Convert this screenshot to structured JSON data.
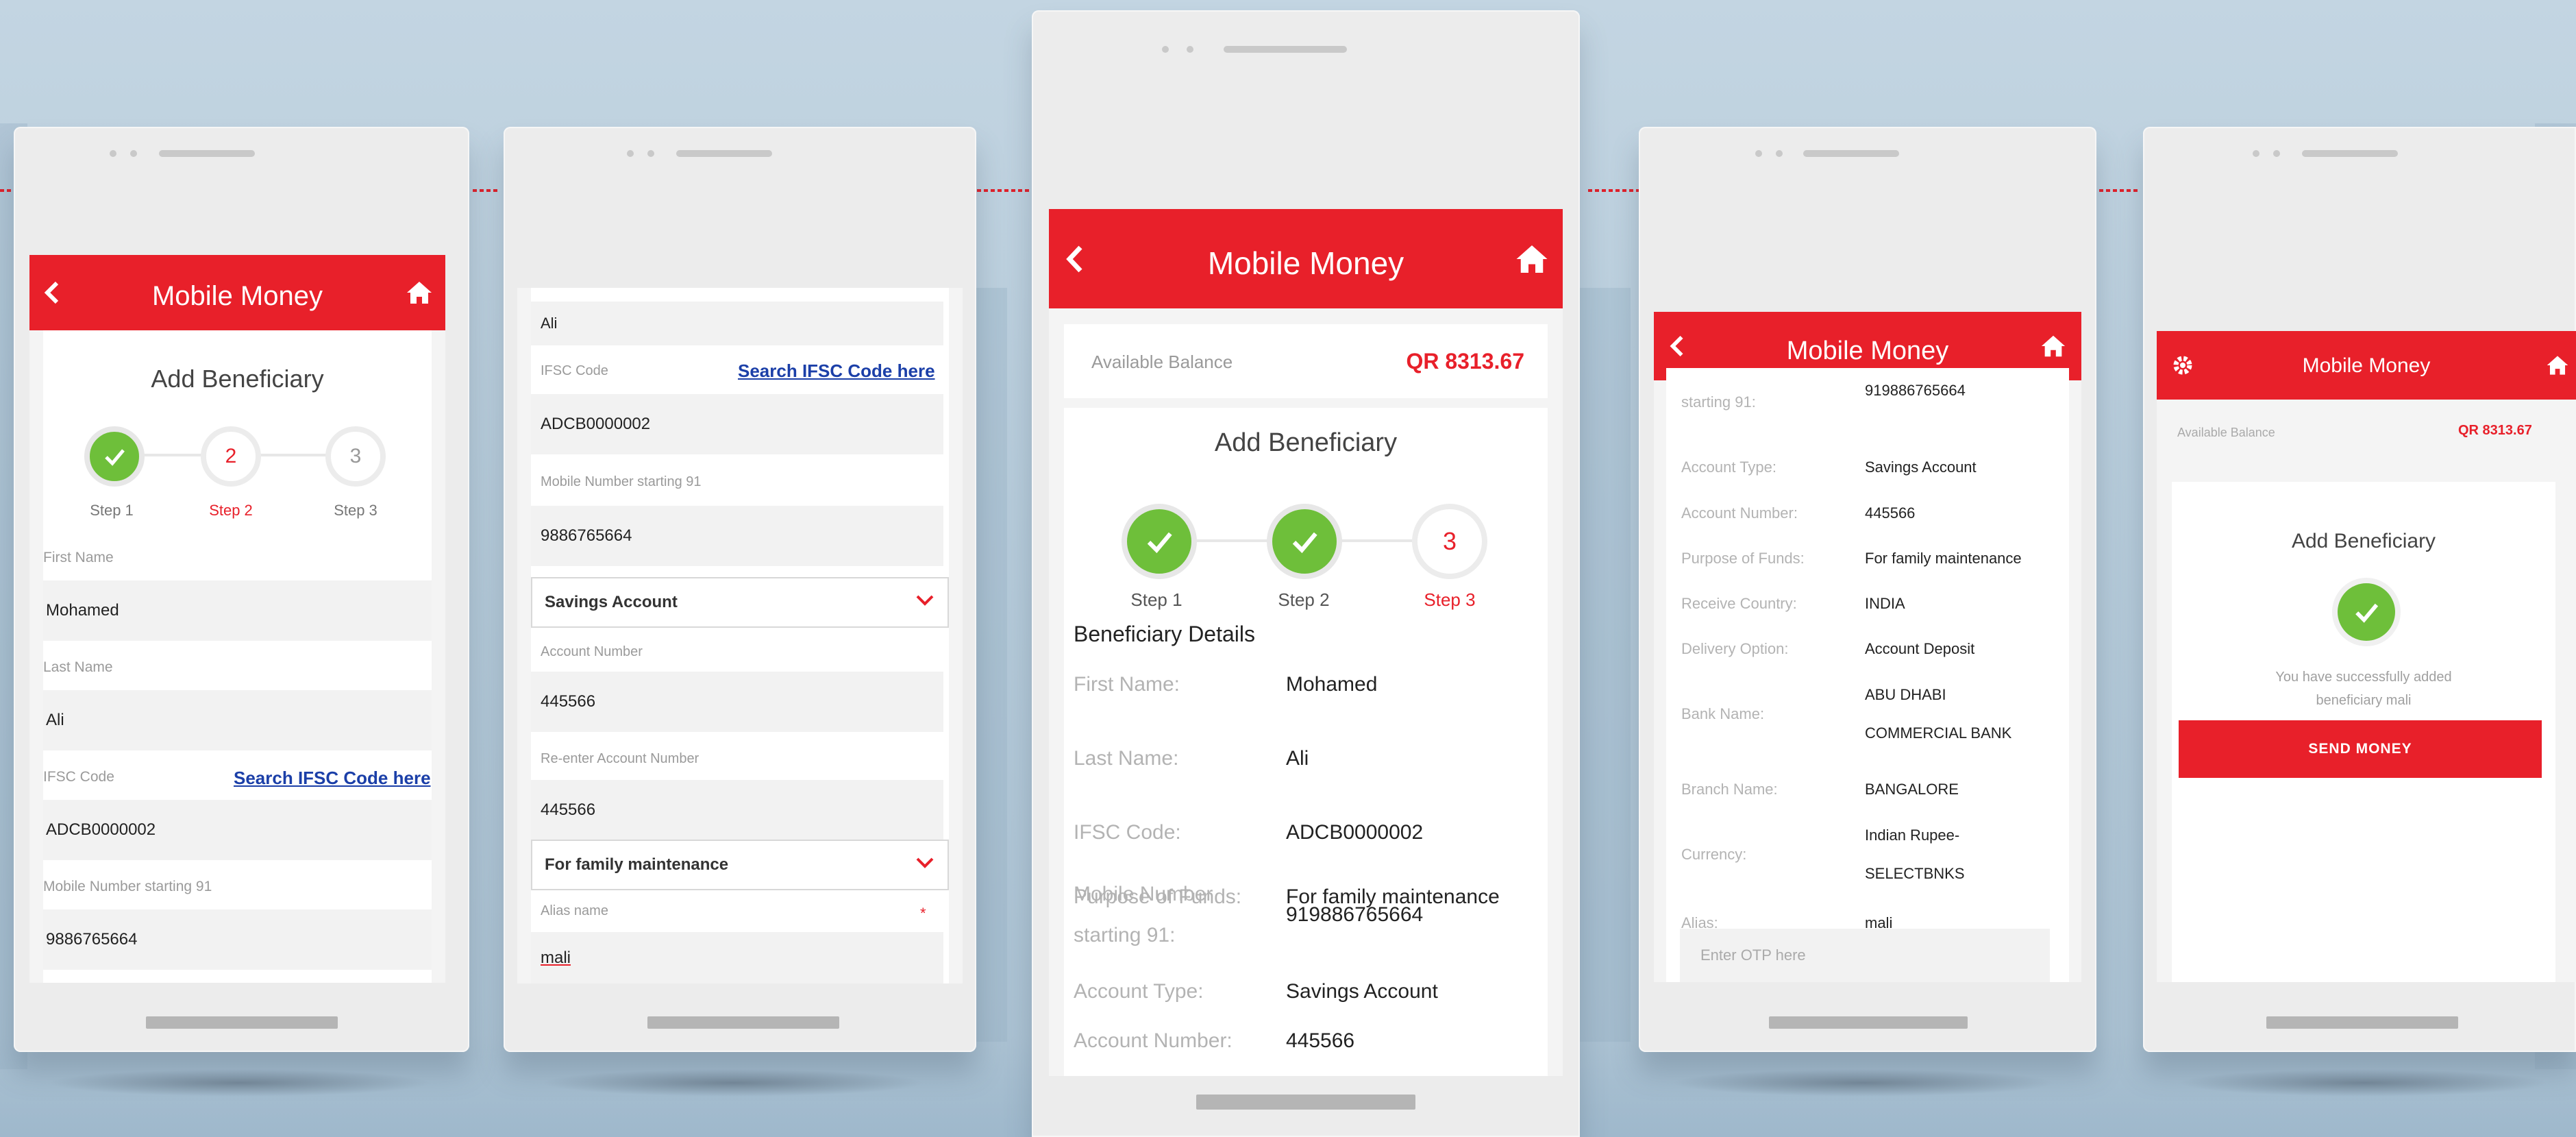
{
  "app_title": "Mobile Money",
  "add_beneficiary": "Add Beneficiary",
  "steps": [
    "Step 1",
    "Step 2",
    "Step 3"
  ],
  "step_numbers": [
    "2",
    "3"
  ],
  "search_ifsc": "Search IFSC Code here",
  "available_balance_label": "Available Balance",
  "balance_value": "QR 8313.67",
  "phone1": {
    "first_name_label": "First Name",
    "first_name": "Mohamed",
    "last_name_label": "Last Name",
    "last_name": "Ali",
    "ifsc_label": "IFSC Code",
    "ifsc": "ADCB0000002",
    "mobile_label": "Mobile Number starting 91",
    "mobile": "9886765664"
  },
  "phone2": {
    "last_name": "Ali",
    "ifsc_label": "IFSC Code",
    "ifsc": "ADCB0000002",
    "mobile_label": "Mobile Number starting 91",
    "mobile": "9886765664",
    "account_type": "Savings Account",
    "account_number_label": "Account Number",
    "account_number": "445566",
    "reenter_label": "Re-enter Account Number",
    "reenter": "445566",
    "purpose": "For family maintenance",
    "alias_label": "Alias name",
    "alias_required": "*",
    "alias": "mali"
  },
  "phone3": {
    "details_title": "Beneficiary Details",
    "rows": [
      {
        "k": "First Name:",
        "v": "Mohamed"
      },
      {
        "k": "Last Name:",
        "v": "Ali"
      },
      {
        "k": "IFSC Code:",
        "v": "ADCB0000002"
      },
      {
        "k": "Mobile Number starting 91:",
        "v": "919886765664"
      },
      {
        "k": "Account Type:",
        "v": "Savings Account"
      },
      {
        "k": "Account Number:",
        "v": "445566"
      },
      {
        "k": "Purpose of Funds:",
        "v": "For family maintenance"
      }
    ]
  },
  "phone4": {
    "top_k": "starting 91:",
    "top_v": "919886765664",
    "rows": [
      {
        "k": "Account Type:",
        "v": "Savings Account"
      },
      {
        "k": "Account Number:",
        "v": "445566"
      },
      {
        "k": "Purpose of Funds:",
        "v": "For family maintenance"
      },
      {
        "k": "Receive Country:",
        "v": "INDIA"
      },
      {
        "k": "Delivery Option:",
        "v": "Account Deposit"
      },
      {
        "k": "Bank Name:",
        "v": "ABU DHABI COMMERCIAL BANK"
      },
      {
        "k": "Branch Name:",
        "v": "BANGALORE"
      },
      {
        "k": "Currency:",
        "v": "Indian Rupee- SELECTBNKS"
      },
      {
        "k": "Alias:",
        "v": "mali"
      }
    ],
    "otp_placeholder": "Enter OTP here"
  },
  "phone5": {
    "success_text": "You have successfully added beneficiary mali",
    "send_money": "SEND MONEY"
  },
  "colors": {
    "accent": "#e8202a",
    "success": "#6ebf3a",
    "link": "#1b3fa8"
  }
}
